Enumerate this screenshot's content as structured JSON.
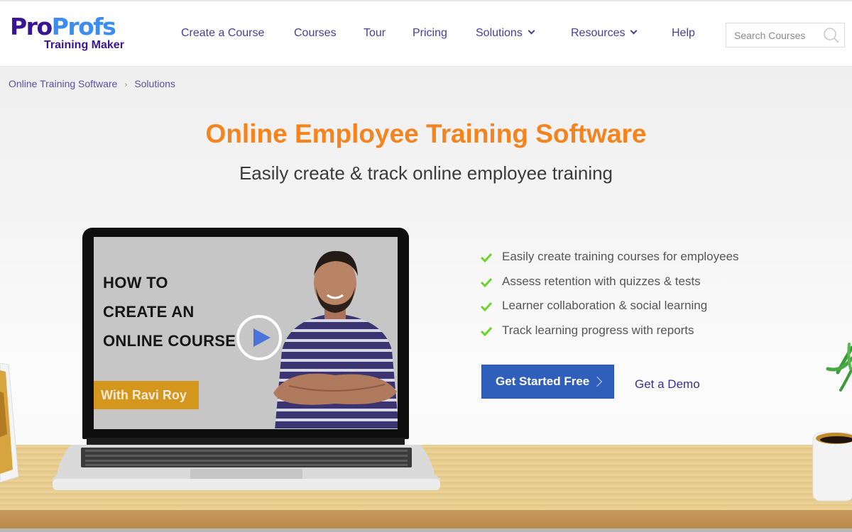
{
  "header": {
    "logo": {
      "part1": "Pro",
      "part2": "Profs",
      "subtitle": "Training Maker"
    },
    "nav": [
      {
        "label": "Create a Course",
        "has_dropdown": false
      },
      {
        "label": "Courses",
        "has_dropdown": false
      },
      {
        "label": "Tour",
        "has_dropdown": false
      },
      {
        "label": "Pricing",
        "has_dropdown": false
      },
      {
        "label": "Solutions",
        "has_dropdown": true
      },
      {
        "label": "Resources",
        "has_dropdown": true
      },
      {
        "label": "Help",
        "has_dropdown": false
      }
    ],
    "search": {
      "placeholder": "Search Courses",
      "value": "",
      "icon": "search-icon"
    }
  },
  "breadcrumb": {
    "items": [
      "Online Training Software",
      "Solutions"
    ],
    "separator": "›"
  },
  "hero": {
    "title": "Online Employee Training Software",
    "subtitle": "Easily create & track online employee training"
  },
  "video": {
    "lines": [
      "HOW TO",
      "CREATE AN",
      "ONLINE COURSE"
    ],
    "presenter": "With Ravi Roy",
    "play_icon": "play-icon"
  },
  "features": [
    "Easily create training courses for employees",
    "Assess retention with quizzes & tests",
    "Learner collaboration & social learning",
    "Track learning progress with reports"
  ],
  "actions": {
    "primary": "Get Started Free",
    "secondary": "Get a Demo"
  },
  "colors": {
    "brand_dark": "#3a1593",
    "brand_light": "#3d8cf2",
    "title_orange": "#f5841f",
    "nav_text": "#4a3b9e",
    "cta_blue": "#2f5fba",
    "check_green": "#6bd42a",
    "badge_gold": "#d4961c"
  }
}
